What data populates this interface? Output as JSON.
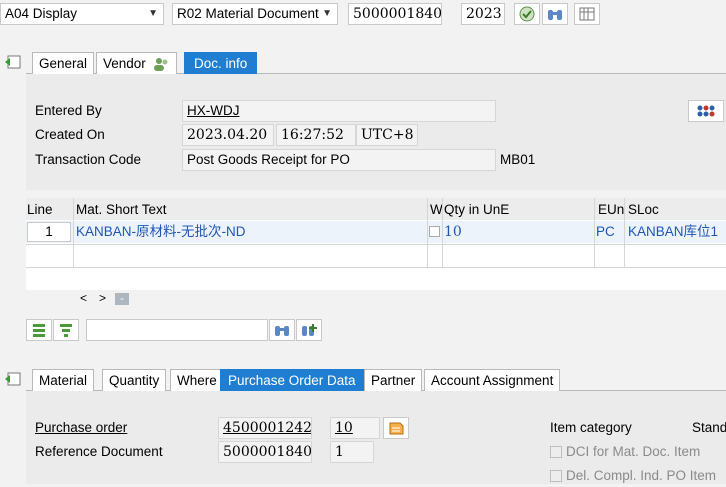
{
  "toolbar": {
    "action_value": "A04 Display",
    "refdoc_value": "R02 Material Document",
    "doc_number": "5000001840",
    "year": "2023"
  },
  "header_tabs": [
    "General",
    "Vendor",
    "Doc. info"
  ],
  "doc_info": {
    "entered_by_label": "Entered By",
    "entered_by_value": "HX-WDJ",
    "created_on_label": "Created On",
    "created_date": "2023.04.20",
    "created_time": "16:27:52",
    "created_tz": "UTC+8",
    "tcode_label": "Transaction Code",
    "tcode_text": "Post Goods Receipt for PO",
    "tcode_value": "MB01"
  },
  "items_table": {
    "headers": {
      "line": "Line",
      "text": "Mat. Short Text",
      "w": "W",
      "qty": "Qty in UnE",
      "eun": "EUn",
      "sloc": "SLoc"
    },
    "rows": [
      {
        "line": "1",
        "text": "KANBAN-原材料-无批次-ND",
        "qty": "10",
        "eun": "PC",
        "sloc": "KANBAN库位1"
      }
    ]
  },
  "pager": {
    "prev": "<",
    "next": ">",
    "collapse": "-"
  },
  "detail_tabs": [
    "Material",
    "Quantity",
    "Where",
    "Purchase Order Data",
    "Partner",
    "Account Assignment"
  ],
  "po_data": {
    "po_label": "Purchase order",
    "po_number": "4500001242",
    "po_item": "10",
    "ref_label": "Reference Document",
    "ref_number": "5000001840",
    "ref_item": "1",
    "item_category_label": "Item category",
    "item_category_value": "Stand",
    "dci_label": "DCI for Mat. Doc. Item",
    "del_compl_label": "Del. Compl. Ind. PO Item"
  },
  "colors": {
    "active_tab": "#1f7ed1",
    "link": "#1f56b5"
  }
}
